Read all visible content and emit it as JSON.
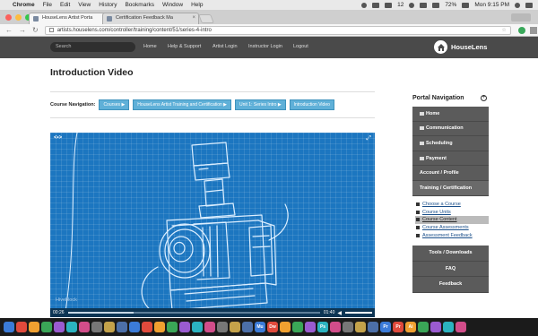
{
  "menubar": {
    "app": "Chrome",
    "items": [
      "File",
      "Edit",
      "View",
      "History",
      "Bookmarks",
      "Window",
      "Help"
    ],
    "status_count": "12",
    "battery": "72%",
    "clock": "Mon 9:15 PM"
  },
  "browser": {
    "tabs": [
      {
        "title": "HouseLens Artist Porta"
      },
      {
        "title": "Certification Feedback Ma"
      }
    ],
    "url": "artists.houselens.com/controller/training/content/51/series-4-intro"
  },
  "header": {
    "search_placeholder": "Search",
    "nav": [
      "Home",
      "Help & Support",
      "Artist Login",
      "Instructor Login",
      "Logout"
    ],
    "logo_text": "HouseLens"
  },
  "page": {
    "title": "Introduction Video",
    "course_nav_label": "Course Navigation:",
    "crumbs": [
      "Courses ▶",
      "HouseLens Artist Training and Certification ▶",
      "Unit 1: Series Intro ▶",
      "Introduction Video"
    ]
  },
  "video": {
    "elapsed": "00:26",
    "duration": "01:40",
    "progress": 0.26,
    "watermark": "Hiveblock",
    "expand_icon": "expand-icon",
    "embed_icon": "embed-icon"
  },
  "sidebar": {
    "title": "Portal Navigation",
    "menu": [
      "Home",
      "Communication",
      "Scheduling",
      "Payment",
      "Account / Profile",
      "Training / Certification"
    ],
    "sub": [
      "Choose a Course",
      "Course Units",
      "Course Content",
      "Course Assessments",
      "Assessment Feedback"
    ],
    "selected_sub_index": 2,
    "tools": [
      "Tools / Downloads",
      "FAQ",
      "Feedback"
    ]
  },
  "dock": {
    "labels": [
      "",
      "",
      "",
      "",
      "",
      "",
      "",
      "",
      "",
      "",
      "",
      "",
      "",
      "",
      "",
      "",
      "",
      "",
      "",
      "",
      "Mu",
      "Dw",
      "",
      "",
      "",
      "Ps",
      "",
      "",
      "",
      "",
      "Pr",
      "Pr",
      "Ai",
      "",
      "",
      "",
      ""
    ]
  },
  "colors": {
    "header_bg": "#4a4a4a",
    "crumb_bg": "#5fb0d8",
    "video_bg": "#1c76c0",
    "sidebar_bg": "#5b5b5b",
    "link": "#1a4f8a"
  }
}
